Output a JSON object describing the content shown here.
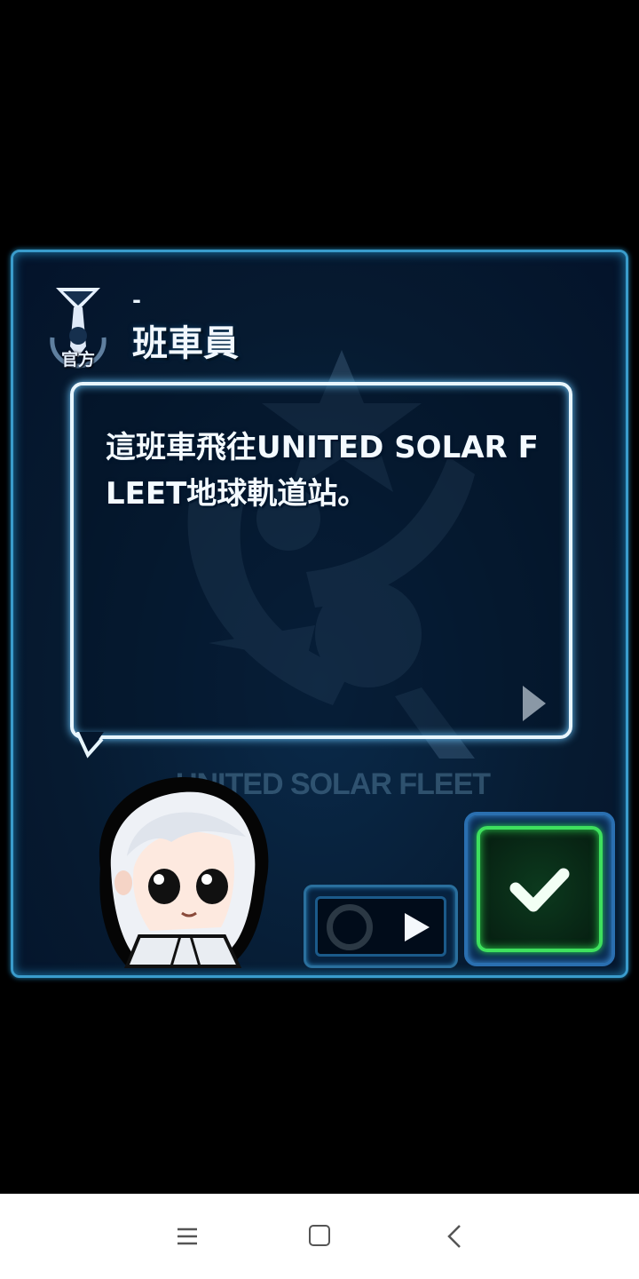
{
  "dialog": {
    "badge_label": "官方",
    "speaker_dash": "-",
    "speaker_name": "班車員",
    "message": "這班車飛往UNITED SOLAR FLEET地球軌道站。",
    "watermark": "UNITED SOLAR FLEET"
  },
  "icons": {
    "badge": "official-badge-icon",
    "next": "next-arrow-icon",
    "auto": "auto-play-icon",
    "confirm": "check-icon"
  },
  "colors": {
    "panel_border": "#3a9ccc",
    "panel_bg": "#061a30",
    "confirm_green": "#3ee05e",
    "text": "#f4faff"
  },
  "navbar": {
    "menu": "menu-icon",
    "home": "home-icon",
    "back": "back-icon"
  }
}
